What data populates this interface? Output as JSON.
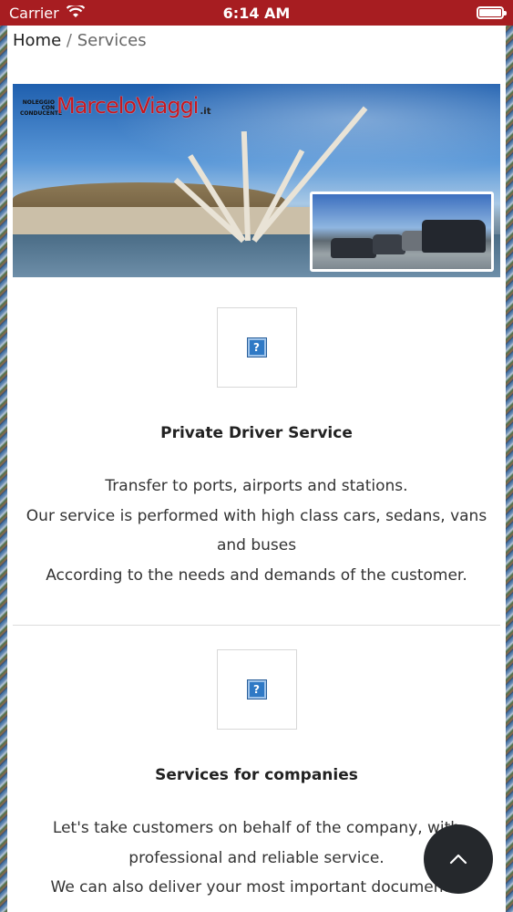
{
  "status_bar": {
    "carrier": "Carrier",
    "time": "6:14 AM",
    "battery_level": 1.0
  },
  "breadcrumb": {
    "home": "Home",
    "separator": "/",
    "current": "Services"
  },
  "banner": {
    "logo_small_lines": [
      "NOLEGGIO",
      "CON",
      "CONDUCENTE"
    ],
    "logo_main": "MarceloViaggi",
    "logo_suffix": ".it"
  },
  "services": [
    {
      "icon": "broken-image-icon",
      "icon_glyph": "?",
      "title": "Private Driver Service",
      "lines": [
        "Transfer to ports, airports and stations.",
        "Our service is performed with high class cars, sedans, vans and buses",
        "According to the needs and demands of the customer."
      ]
    },
    {
      "icon": "broken-image-icon",
      "icon_glyph": "?",
      "title": "Services for companies",
      "lines": [
        "Let's take customers on behalf of the company, with professional and reliable service.",
        "We can also deliver your most important documents."
      ]
    }
  ],
  "fab": {
    "icon": "chevron-up-icon"
  },
  "colors": {
    "status_bar_bg": "#a71d21",
    "logo_red": "#c8161d",
    "fab_bg": "#25282c"
  }
}
